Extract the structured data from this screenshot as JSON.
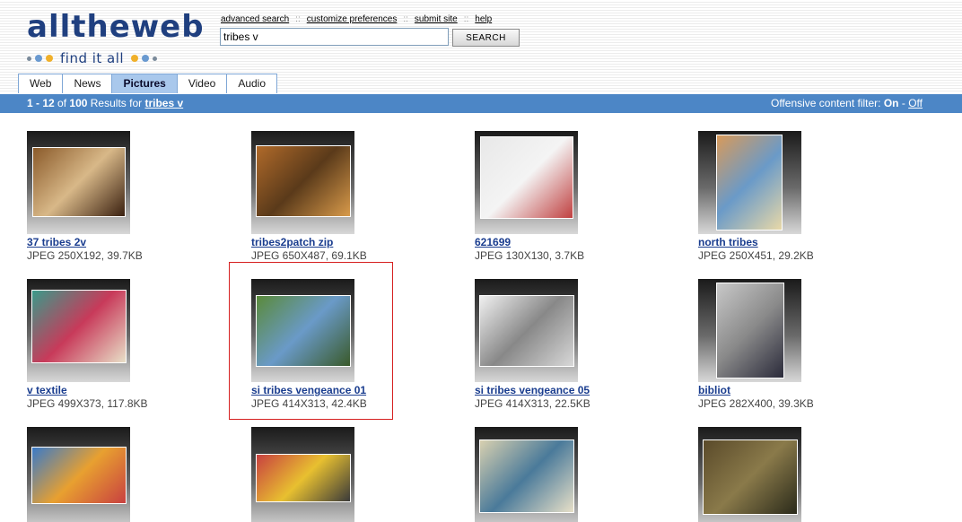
{
  "logo": {
    "word": "alltheweb",
    "tagline": "find it all"
  },
  "toplinks": [
    "advanced search",
    "customize preferences",
    "submit site",
    "help"
  ],
  "toplinks_sep": "::",
  "search": {
    "value": "tribes v",
    "button": "SEARCH"
  },
  "tabs": [
    {
      "label": "Web",
      "active": false
    },
    {
      "label": "News",
      "active": false
    },
    {
      "label": "Pictures",
      "active": true
    },
    {
      "label": "Video",
      "active": false
    },
    {
      "label": "Audio",
      "active": false
    }
  ],
  "results": {
    "range": "1 - 12",
    "of": "of",
    "total": "100",
    "results_for": "Results for",
    "query": "tribes v",
    "filter_label": "Offensive content filter:",
    "filter_on": "On",
    "filter_dash": "-",
    "filter_off": "Off"
  },
  "items": [
    {
      "title": "37 tribes 2v",
      "meta": "JPEG 250X192, 39.7KB",
      "colors": [
        "#8a5a2a",
        "#d8b888",
        "#3a2010"
      ]
    },
    {
      "title": "tribes2patch zip",
      "meta": "JPEG 650X487, 69.1KB",
      "colors": [
        "#b06a2a",
        "#5a3a1a",
        "#d89a4a"
      ]
    },
    {
      "title": "621699",
      "meta": "JPEG 130X130, 3.7KB",
      "colors": [
        "#e8e8e8",
        "#f4f4f4",
        "#c04040"
      ]
    },
    {
      "title": "north tribes",
      "meta": "JPEG 250X451, 29.2KB",
      "colors": [
        "#d89a5a",
        "#6a9ac8",
        "#e8d8a8"
      ]
    },
    {
      "title": "v textile",
      "meta": "JPEG 499X373, 117.8KB",
      "colors": [
        "#3a9a8a",
        "#c83a5a",
        "#e8e0c8"
      ]
    },
    {
      "title": "si tribes vengeance 01",
      "meta": "JPEG 414X313, 42.4KB",
      "colors": [
        "#5a8a3a",
        "#6a9ac8",
        "#3a5a2a"
      ]
    },
    {
      "title": "si tribes vengeance 05",
      "meta": "JPEG 414X313, 22.5KB",
      "colors": [
        "#f0f0f0",
        "#888888",
        "#d8d8d8"
      ]
    },
    {
      "title": "bibliot",
      "meta": "JPEG 282X400, 39.3KB",
      "colors": [
        "#c8c8c8",
        "#8a8a8a",
        "#2a2a3a"
      ]
    },
    {
      "title": "",
      "meta": "",
      "colors": [
        "#3a7ac8",
        "#e8a030",
        "#c84040"
      ]
    },
    {
      "title": "",
      "meta": "",
      "colors": [
        "#c84040",
        "#e8c030",
        "#3a3a3a"
      ]
    },
    {
      "title": "",
      "meta": "",
      "colors": [
        "#d8d0b0",
        "#4a7a9a",
        "#e8e0c8"
      ]
    },
    {
      "title": "",
      "meta": "",
      "colors": [
        "#5a4a2a",
        "#8a7a4a",
        "#2a2a1a"
      ]
    }
  ]
}
